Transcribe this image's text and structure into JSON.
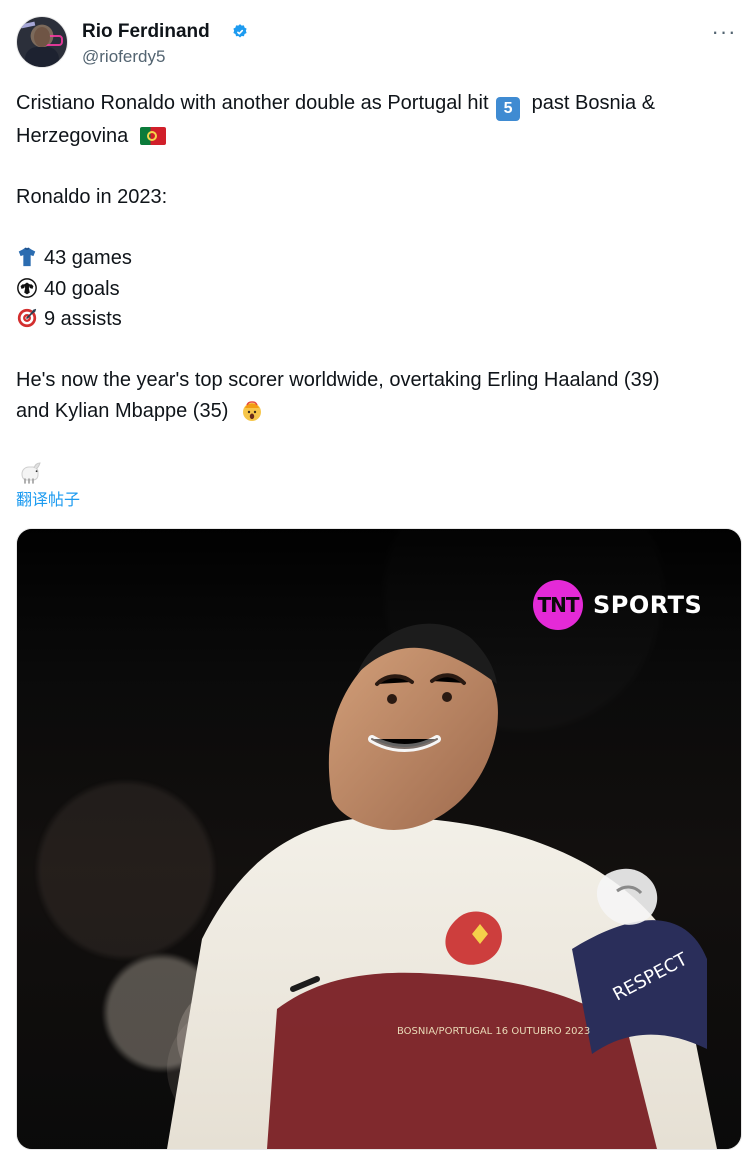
{
  "header": {
    "display_name": "Rio Ferdinand",
    "handle": "@rioferdy5",
    "more_label": "···"
  },
  "tweet": {
    "line1": "Cristiano Ronaldo with another double as Portugal hit",
    "line1_number": "5",
    "line1_tail": "past Bosnia &",
    "line2": "Herzegovina",
    "intro": "Ronaldo in 2023:",
    "stats": [
      {
        "icon": "jersey-icon",
        "text": "43 games"
      },
      {
        "icon": "soccer-ball-icon",
        "text": "40 goals"
      },
      {
        "icon": "target-icon",
        "text": "9 assists"
      }
    ],
    "closing_line1": "He's now the year's top scorer worldwide, overtaking Erling Haaland (39)",
    "closing_line2": "and Kylian Mbappe (35)"
  },
  "translate": {
    "label": "翻译帖子"
  },
  "media": {
    "brand_mark": "TNT",
    "brand_text": "SPORTS",
    "captain_band_text": "RESPECT",
    "jersey_print": "BOSNIA/PORTUGAL 16 OUTUBRO 2023"
  },
  "colors": {
    "link": "#1d9bf0",
    "text_primary": "#0f1419",
    "text_secondary": "#536471",
    "tnt_magenta": "#e42ad7"
  }
}
